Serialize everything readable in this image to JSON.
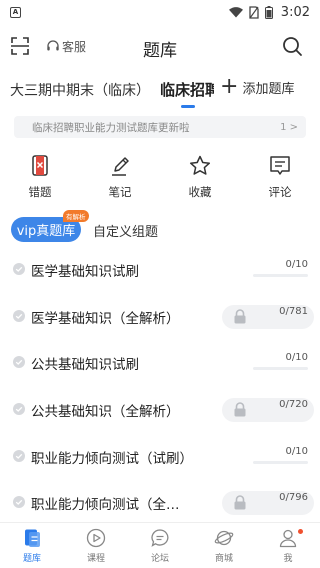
{
  "status_bar": {
    "time": "3:02",
    "app_glyph": "A"
  },
  "header": {
    "title": "题库",
    "service_label": "客服"
  },
  "tabs": {
    "left": "大三期中期末（临床）",
    "active": "临床招聘",
    "add_label": "添加题库"
  },
  "notice": {
    "text": "临床招聘职业能力测试题库更新啦",
    "page": "1 >"
  },
  "quick_actions": [
    {
      "label": "错题",
      "icon": "wrong-questions-icon"
    },
    {
      "label": "笔记",
      "icon": "notes-pen-icon"
    },
    {
      "label": "收藏",
      "icon": "star-icon"
    },
    {
      "label": "评论",
      "icon": "comment-icon"
    }
  ],
  "segments": {
    "vip": "vip真题库",
    "vip_badge": "有解析",
    "custom": "自定义组题"
  },
  "list": [
    {
      "title": "医学基础知识试刷",
      "count": "0/10",
      "locked": false
    },
    {
      "title": "医学基础知识（全解析）",
      "count": "0/781",
      "locked": true
    },
    {
      "title": "公共基础知识试刷",
      "count": "0/10",
      "locked": false
    },
    {
      "title": "公共基础知识（全解析）",
      "count": "0/720",
      "locked": true
    },
    {
      "title": "职业能力倾向测试（试刷）",
      "count": "0/10",
      "locked": false
    },
    {
      "title": "职业能力倾向测试（全解析）",
      "count": "0/796",
      "locked": true
    }
  ],
  "bottom_nav": [
    {
      "label": "题库",
      "active": true
    },
    {
      "label": "课程",
      "active": false
    },
    {
      "label": "论坛",
      "active": false
    },
    {
      "label": "商城",
      "active": false
    },
    {
      "label": "我",
      "active": false
    }
  ],
  "colors": {
    "accent": "#2b7bea",
    "vip_pill": "#3d86e8",
    "badge": "#f27a2b",
    "quick_icon_red": "#e04a3f",
    "notification_dot": "#f0502e"
  }
}
